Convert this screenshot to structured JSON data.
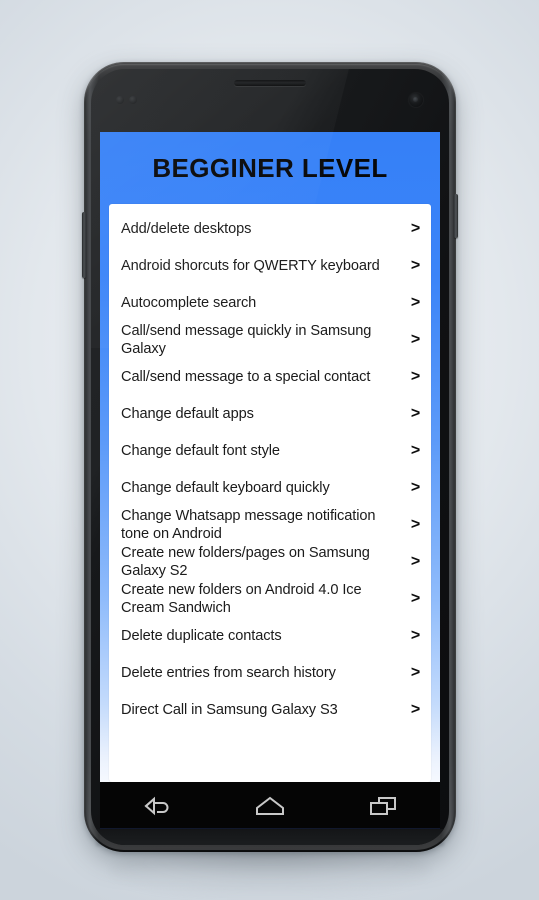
{
  "app": {
    "title": "BEGGINER LEVEL",
    "header_color": "#3580f7",
    "background_gradient_top": "#3580f7",
    "background_gradient_bottom": "#f6f9fe",
    "list_background": "#ffffff",
    "chevron_glyph": "›"
  },
  "list": {
    "items": [
      {
        "label": "Add/delete desktops",
        "chevron": ">"
      },
      {
        "label": "Android shorcuts for QWERTY keyboard",
        "chevron": ">"
      },
      {
        "label": "Autocomplete search",
        "chevron": ">"
      },
      {
        "label": "Call/send message quickly in Samsung Galaxy",
        "chevron": ">"
      },
      {
        "label": "Call/send message to a special contact",
        "chevron": ">"
      },
      {
        "label": "Change default apps",
        "chevron": ">"
      },
      {
        "label": "Change default font style",
        "chevron": ">"
      },
      {
        "label": "Change default keyboard quickly",
        "chevron": ">"
      },
      {
        "label": "Change Whatsapp message notification tone on Android",
        "chevron": ">"
      },
      {
        "label": "Create new folders/pages on Samsung Galaxy S2",
        "chevron": ">"
      },
      {
        "label": "Create new folders on Android 4.0 Ice Cream Sandwich",
        "chevron": ">"
      },
      {
        "label": "Delete duplicate contacts",
        "chevron": ">"
      },
      {
        "label": "Delete entries from search history",
        "chevron": ">"
      },
      {
        "label": "Direct Call in Samsung Galaxy S3",
        "chevron": ">"
      }
    ]
  },
  "navbar": {
    "buttons": [
      {
        "name": "back",
        "label": "Back"
      },
      {
        "name": "home",
        "label": "Home"
      },
      {
        "name": "recents",
        "label": "Recent apps"
      }
    ]
  },
  "device": {
    "hardware": {
      "earpiece": "earpiece-speaker",
      "front_camera": "front-camera",
      "proximity_sensor": "proximity-sensor",
      "power_button": "power-button",
      "volume_button": "volume-button"
    }
  }
}
